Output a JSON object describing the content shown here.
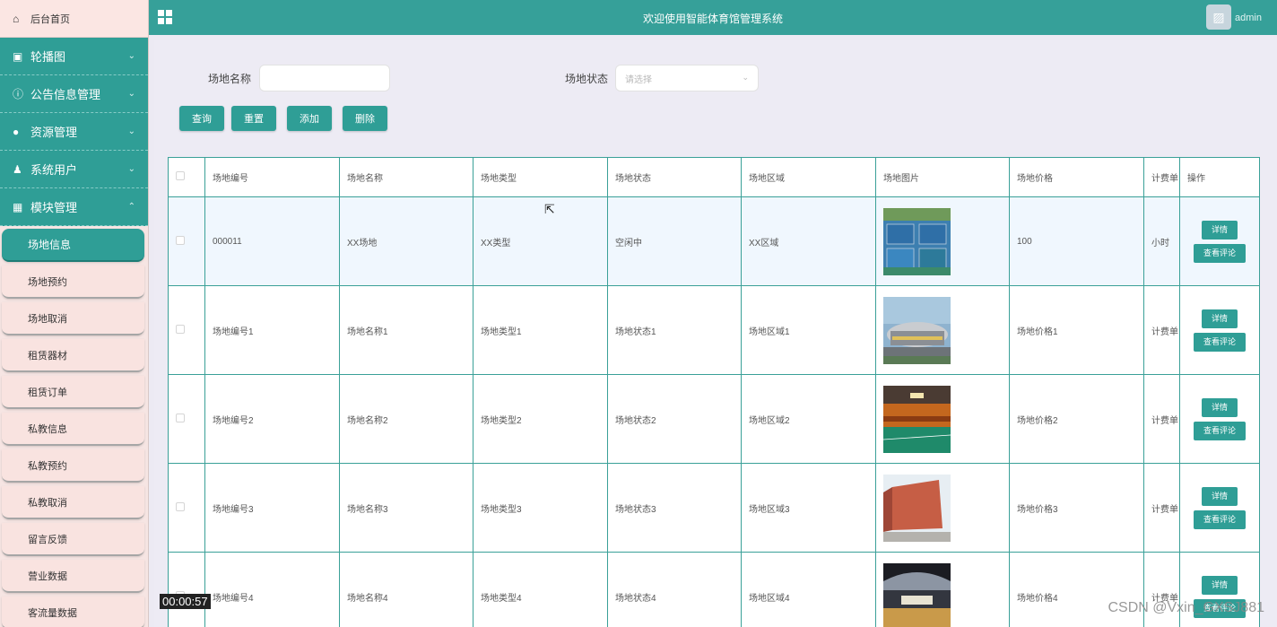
{
  "sidebar": {
    "home": {
      "label": "后台首页",
      "icon": "home-icon"
    },
    "menus": [
      {
        "label": "轮播图",
        "icon": "image-icon"
      },
      {
        "label": "公告信息管理",
        "icon": "info-icon"
      },
      {
        "label": "资源管理",
        "icon": "bulb-icon"
      },
      {
        "label": "系统用户",
        "icon": "user-icon"
      },
      {
        "label": "模块管理",
        "icon": "grid-icon"
      }
    ],
    "sub_items": [
      "场地信息",
      "场地预约",
      "场地取消",
      "租赁器材",
      "租赁订单",
      "私教信息",
      "私教预约",
      "私教取消",
      "留言反馈",
      "营业数据",
      "客流量数据"
    ]
  },
  "header": {
    "title": "欢迎使用智能体育馆管理系统",
    "user": "admin"
  },
  "search": {
    "name_label": "场地名称",
    "name_value": "",
    "status_label": "场地状态",
    "status_placeholder": "请选择"
  },
  "buttons": {
    "query": "查询",
    "reset": "重置",
    "add": "添加",
    "delete": "删除"
  },
  "table": {
    "headers": [
      "场地编号",
      "场地名称",
      "场地类型",
      "场地状态",
      "场地区域",
      "场地图片",
      "场地价格",
      "计费单",
      "操作"
    ],
    "rows": [
      [
        "000011",
        "XX场地",
        "XX类型",
        "空闲中",
        "XX区域",
        "100",
        "小时"
      ],
      [
        "场地编号1",
        "场地名称1",
        "场地类型1",
        "场地状态1",
        "场地区域1",
        "场地价格1",
        "计费单"
      ],
      [
        "场地编号2",
        "场地名称2",
        "场地类型2",
        "场地状态2",
        "场地区域2",
        "场地价格2",
        "计费单"
      ],
      [
        "场地编号3",
        "场地名称3",
        "场地类型3",
        "场地状态3",
        "场地区域3",
        "场地价格3",
        "计费单"
      ],
      [
        "场地编号4",
        "场地名称4",
        "场地类型4",
        "场地状态4",
        "场地区域4",
        "场地价格4",
        "计费单"
      ]
    ],
    "detail_label": "详情",
    "comment_label": "查看评论"
  },
  "overlay": {
    "timer": "00:00:57",
    "watermark": "CSDN @Vxin_GXSJ881"
  },
  "colors": {
    "accent": "#2f9e96",
    "header": "#36a099",
    "sidebar_bg": "#f6e5e3"
  }
}
